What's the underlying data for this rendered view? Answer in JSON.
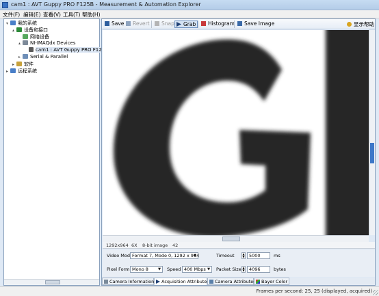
{
  "window": {
    "title": "cam1 : AVT Guppy PRO F125B - Measurement & Automation Explorer"
  },
  "menu": [
    "文件(F)",
    "编辑(E)",
    "查看(V)",
    "工具(T)",
    "帮助(H)"
  ],
  "tree": {
    "items": [
      {
        "label": "我的系统",
        "expander": "▾"
      },
      {
        "label": "设备和接口",
        "expander": "▴"
      },
      {
        "label": "网络设备",
        "expander": ""
      },
      {
        "label": "NI-IMAQdx Devices",
        "expander": "▴"
      },
      {
        "label": "cam1 : AVT Guppy PRO F125",
        "expander": ""
      },
      {
        "label": "Serial & Parallel",
        "expander": "▸"
      },
      {
        "label": "软件",
        "expander": "▸"
      },
      {
        "label": "远程系统",
        "expander": "▸"
      }
    ]
  },
  "toolbar": {
    "save": "Save",
    "revert": "Revert",
    "snap": "Snap",
    "grab": "Grab",
    "histogram": "Histogram",
    "save_image": "Save Image",
    "help": "显示帮助"
  },
  "image": {
    "glyphs": "GI",
    "colors": {
      "ink": "#262626",
      "background": "#ffffff"
    }
  },
  "info": {
    "resolution": "1292x964",
    "zoom": "6X",
    "type": "8-bit image",
    "value": "42"
  },
  "settings": {
    "video_mode_label": "Video Mode",
    "video_mode_value": "Format 7, Mode 0, 1292 x 964",
    "pixel_format_label": "Pixel Format",
    "pixel_format_value": "Mono 8",
    "speed_label": "Speed",
    "speed_value": "400 Mbps",
    "timeout_label": "Timeout",
    "timeout_value": "5000",
    "timeout_unit": "ms",
    "packet_size_label": "Packet Size",
    "packet_size_value": "4096",
    "packet_size_unit": "bytes"
  },
  "tabs": [
    "Camera Information",
    "Acquisition Attributes",
    "Camera Attributes",
    "Bayer Color"
  ],
  "status": "Frames per second: 25, 25 (displayed, acquired)",
  "colors": {
    "accent": "#3d78c8",
    "pane_border": "#8aa1bd",
    "selection": "#dbe6f4"
  }
}
